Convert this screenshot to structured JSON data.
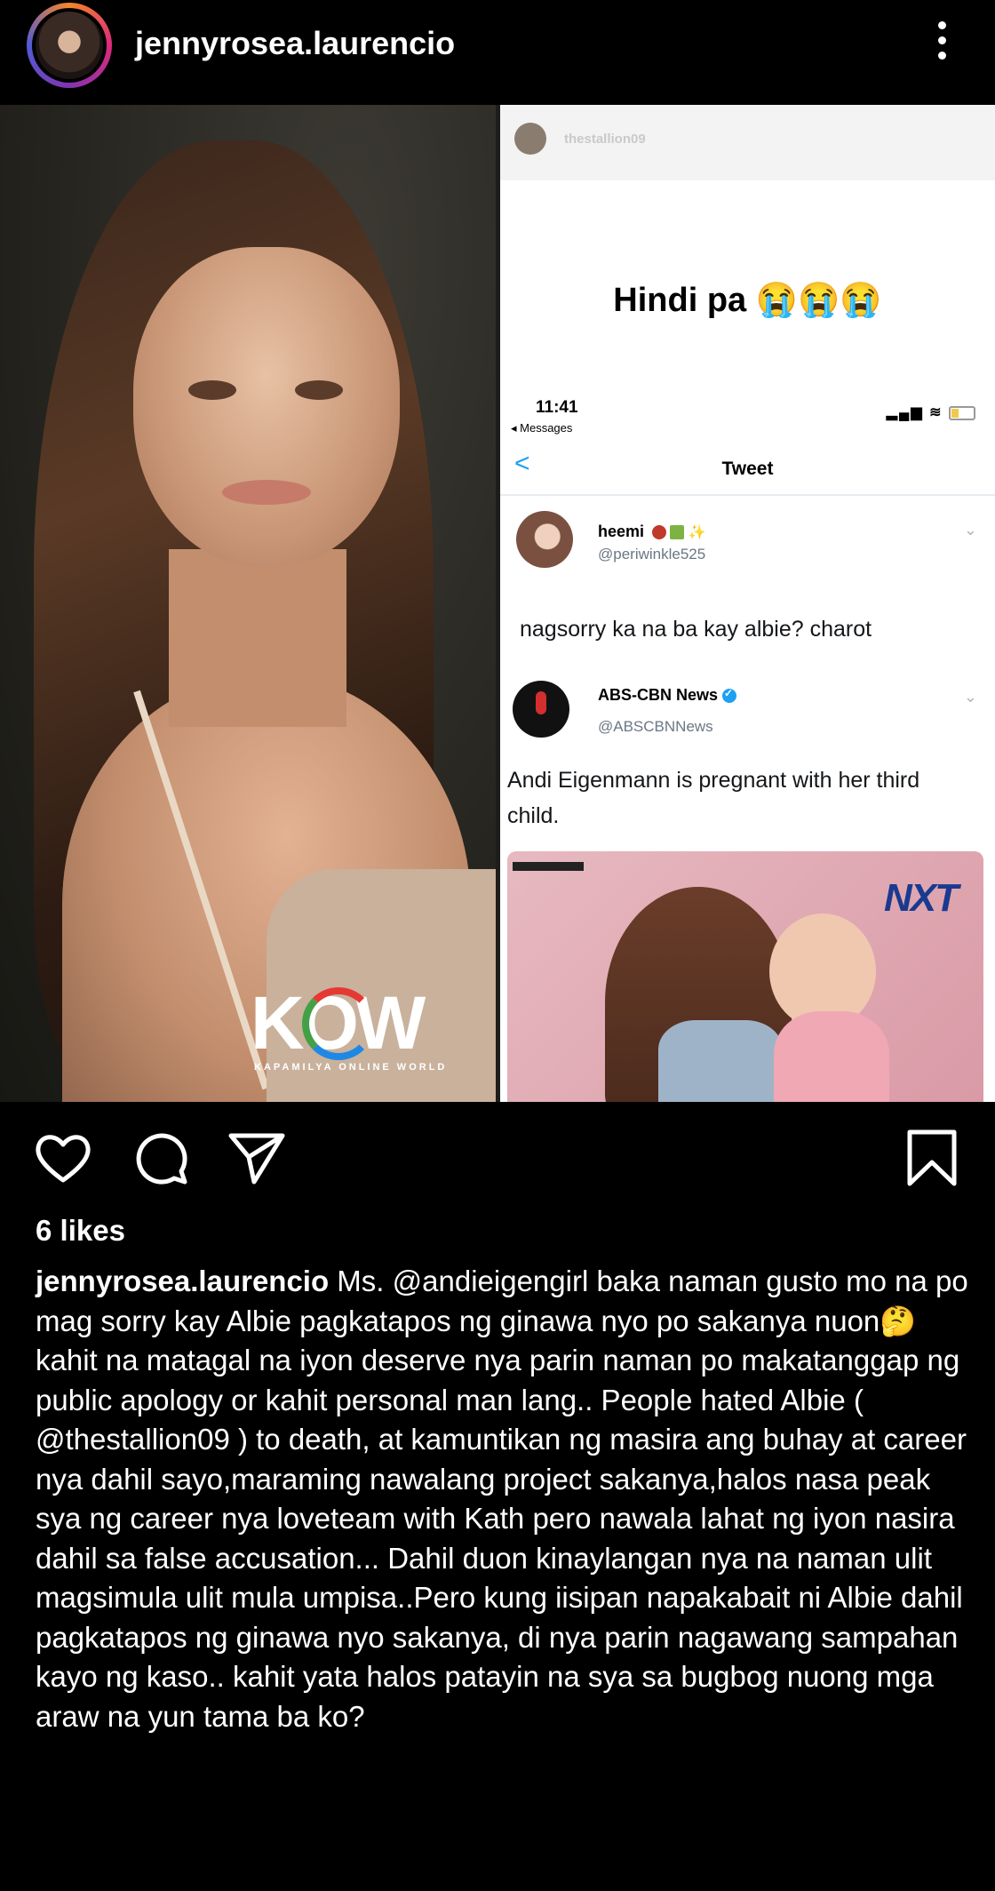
{
  "header": {
    "username": "jennyrosea.laurencio"
  },
  "post_image": {
    "left_logo": {
      "text": "KOW",
      "subtitle": "KAPAMILYA ONLINE WORLD"
    },
    "screenshot": {
      "story_user": "thestallion09",
      "story_text": "Hindi pa 😭😭😭",
      "phone_time": "11:41",
      "phone_back": "◂ Messages",
      "nav_back": "<",
      "nav_title": "Tweet",
      "reply": {
        "name": "heemi",
        "handle": "@periwinkle525",
        "text": "nagsorry ka na ba kay albie? charot"
      },
      "quoted": {
        "name": "ABS-CBN News",
        "handle": "@ABSCBNNews",
        "text": "Andi Eigenmann is pregnant with her third child.",
        "image_logo": "NXT"
      }
    }
  },
  "actions": {
    "icons": [
      "heart-icon",
      "comment-icon",
      "share-icon",
      "bookmark-icon"
    ]
  },
  "likes": "6 likes",
  "caption": {
    "user": "jennyrosea.laurencio",
    "text": " Ms. @andieigengirl baka naman gusto mo na po mag sorry kay Albie pagkatapos ng ginawa nyo po sakanya nuon🤔kahit na matagal na iyon deserve nya parin naman po makatanggap ng public apology or kahit personal man lang.. People hated Albie ( @thestallion09 ) to death, at kamuntikan ng masira ang buhay at career nya dahil sayo,maraming nawalang project sakanya,halos nasa peak sya ng career nya loveteam with Kath pero nawala lahat ng iyon nasira dahil sa false accusation... Dahil duon kinaylangan nya na naman ulit magsimula ulit mula umpisa..Pero kung iisipan napakabait ni Albie dahil pagkatapos ng ginawa nyo sakanya, di nya parin nagawang sampahan kayo ng kaso.. kahit yata halos patayin na sya sa bugbog nuong mga araw na yun tama ba ko?"
  }
}
